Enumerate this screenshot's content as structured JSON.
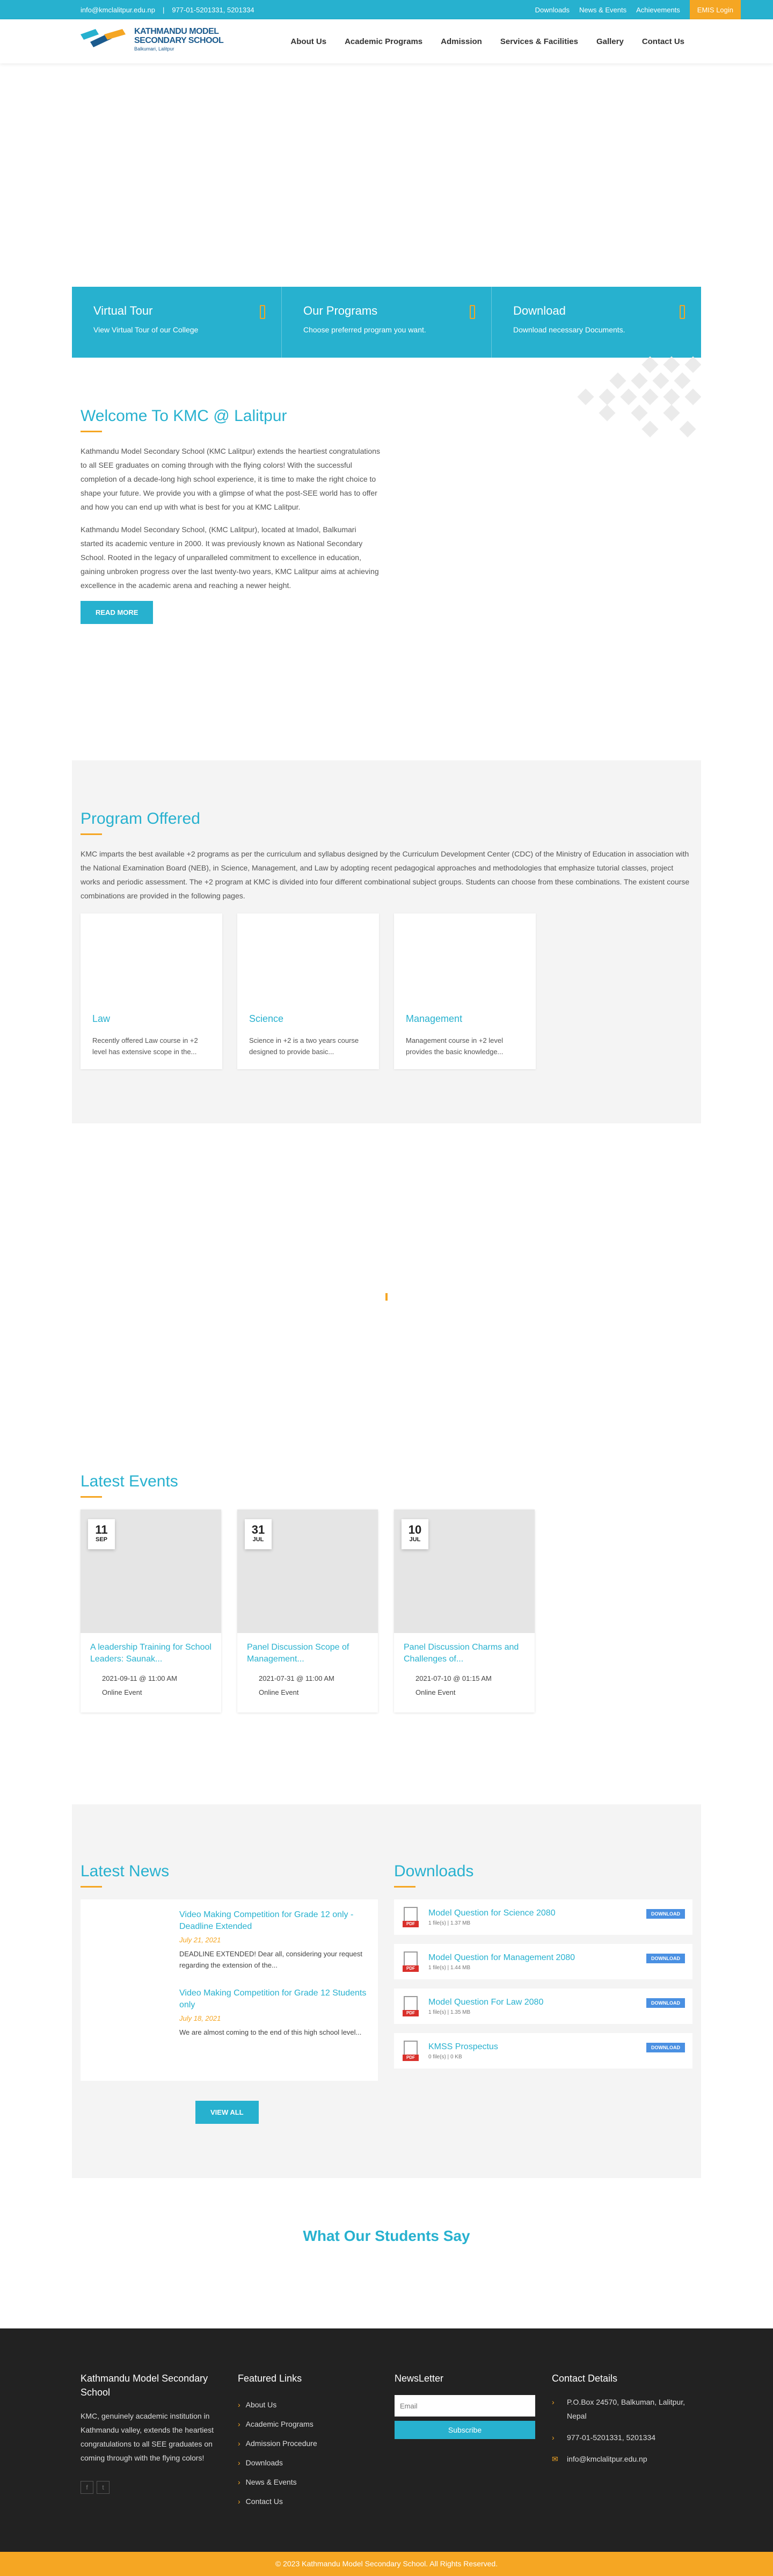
{
  "topbar": {
    "email": "info@kmclalitpur.edu.np",
    "phone": "977-01-5201331, 5201334",
    "links": [
      "Downloads",
      "News & Events",
      "Achievements"
    ],
    "login": "EMIS Login"
  },
  "header": {
    "logo_line1": "KATHMANDU MODEL",
    "logo_line2": "SECONDARY SCHOOL",
    "logo_line3": "Balkumari, Lalitpur",
    "nav": [
      "About Us",
      "Academic Programs",
      "Admission",
      "Services & Facilities",
      "Gallery",
      "Contact Us"
    ]
  },
  "features": [
    {
      "title": "Virtual Tour",
      "text": "View Virtual Tour of our College"
    },
    {
      "title": "Our Programs",
      "text": "Choose preferred program you want."
    },
    {
      "title": "Download",
      "text": "Download necessary Documents."
    }
  ],
  "welcome": {
    "title": "Welcome To KMC @ Lalitpur",
    "para1": "Kathmandu Model Secondary School (KMC Lalitpur) extends the heartiest congratulations to all SEE graduates on coming through with the flying colors! With the successful completion of a decade-long high school experience, it is time to make the right choice to shape your future. We provide you with a glimpse of what the post-SEE world has to offer and how you can end up with what is best for you at KMC Lalitpur.",
    "para2": "Kathmandu Model Secondary School, (KMC Lalitpur), located at Imadol, Balkumari started its academic venture in 2000. It was previously known as National Secondary School. Rooted in the legacy of unparalleled commitment to excellence in education, gaining unbroken progress over the last twenty-two years, KMC Lalitpur aims at achieving excellence in the academic arena and reaching a newer height.",
    "button": "READ MORE"
  },
  "programs": {
    "title": "Program Offered",
    "description": "KMC imparts the best available +2 programs as per the curriculum and syllabus designed by the Curriculum Development Center (CDC) of the Ministry of Education in association with the National Examination Board (NEB), in Science, Management, and Law by adopting recent pedagogical approaches and methodologies that emphasize tutorial classes, project works and periodic assessment. The +2 program at KMC is divided into four different combinational subject groups. Students can choose from these combinations. The existent course combinations are provided in the following pages.",
    "items": [
      {
        "title": "Law",
        "text": "Recently offered Law course in +2 level has extensive scope in the..."
      },
      {
        "title": "Science",
        "text": "Science in +2 is a two years course designed to provide basic..."
      },
      {
        "title": "Management",
        "text": "Management course in +2 level provides the basic knowledge..."
      }
    ]
  },
  "events": {
    "title": "Latest Events",
    "items": [
      {
        "day": "11",
        "month": "SEP",
        "title": "A leadership Training for School Leaders: Saunak...",
        "datetime": "2021-09-11 @ 11:00 AM",
        "location": "Online Event"
      },
      {
        "day": "31",
        "month": "JUL",
        "title": "Panel Discussion Scope of Management...",
        "datetime": "2021-07-31 @ 11:00 AM",
        "location": "Online Event"
      },
      {
        "day": "10",
        "month": "JUL",
        "title": "Panel Discussion Charms and Challenges of...",
        "datetime": "2021-07-10 @ 01:15 AM",
        "location": "Online Event"
      }
    ]
  },
  "news": {
    "title": "Latest News",
    "items": [
      {
        "title": "Video Making Competition for Grade 12 only - Deadline Extended",
        "date": "July 21, 2021",
        "text": "DEADLINE EXTENDED! Dear all, considering your request regarding the extension of the..."
      },
      {
        "title": "Video Making Competition for Grade 12 Students only",
        "date": "July 18, 2021",
        "text": "We are almost coming to the end of this high school level..."
      }
    ],
    "view_all": "VIEW ALL"
  },
  "downloads": {
    "title": "Downloads",
    "button": "DOWNLOAD",
    "items": [
      {
        "title": "Model Question for Science 2080",
        "meta": "1 file(s)  |  1.37 MB"
      },
      {
        "title": "Model Question for Management 2080",
        "meta": "1 file(s)  |  1.44 MB"
      },
      {
        "title": "Model Question For Law 2080",
        "meta": "1 file(s)  |  1.35 MB"
      },
      {
        "title": "KMSS Prospectus",
        "meta": "0 file(s)  |  0 KB"
      }
    ]
  },
  "testimonials": {
    "title": "What Our Students Say"
  },
  "footer": {
    "about_title": "Kathmandu Model Secondary School",
    "about_text": "KMC, genuinely academic institution in Kathmandu valley, extends the heartiest congratulations to all SEE graduates on coming through with the flying colors!",
    "links_title": "Featured Links",
    "links": [
      "About Us",
      "Academic Programs",
      "Admission Procedure",
      "Downloads",
      "News & Events",
      "Contact Us"
    ],
    "newsletter_title": "NewsLetter",
    "email_placeholder": "Email",
    "subscribe": "Subscribe",
    "contact_title": "Contact Details",
    "address": "P.O.Box 24570, Balkuman, Lalitpur, Nepal",
    "phone": "977-01-5201331, 5201334",
    "email": "info@kmclalitpur.edu.np",
    "copyright": "© 2023 Kathmandu Model Secondary School. All Rights Reserved."
  },
  "colors": {
    "accent": "#27b1cf",
    "orange": "#f5a623",
    "footer": "#222222"
  }
}
